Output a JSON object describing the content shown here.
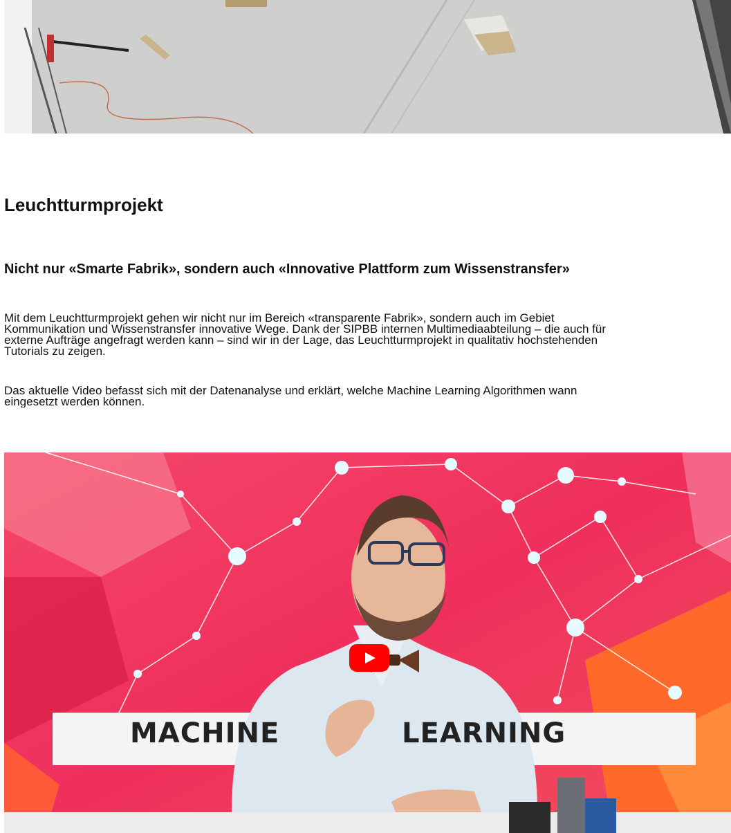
{
  "hero": {
    "image": "factory-hall-photo"
  },
  "section": {
    "title": "Leuchtturmprojekt",
    "subtitle": "Nicht nur «Smarte Fabrik», sondern auch «Innovative Plattform zum Wissenstransfer»",
    "paragraph1_lines": [
      "Mit dem Leuchtturmprojekt gehen wir nicht nur im Bereich «transparente Fabrik», sondern auch im Gebiet",
      "Kommunikation und Wissenstransfer innovative Wege. Dank der SIPBB internen Multimediaabteilung – die auch für",
      "externe Aufträge angefragt werden kann – sind wir in der Lage, das Leuchtturmprojekt in qualitativ hochstehenden",
      "Tutorials zu zeigen."
    ],
    "paragraph2_lines": [
      "Das aktuelle Video befasst sich mit der Datenanalyse und erklärt, welche Machine Learning Algorithmen wann",
      "eingesetzt werden können."
    ]
  },
  "video": {
    "banner_left": "MACHINE",
    "banner_right": "LEARNING",
    "play_icon": "youtube-play-icon",
    "colors": {
      "background": "#f23a61",
      "accent_orange": "#ff6a2b",
      "play_red": "#ff0000"
    }
  }
}
